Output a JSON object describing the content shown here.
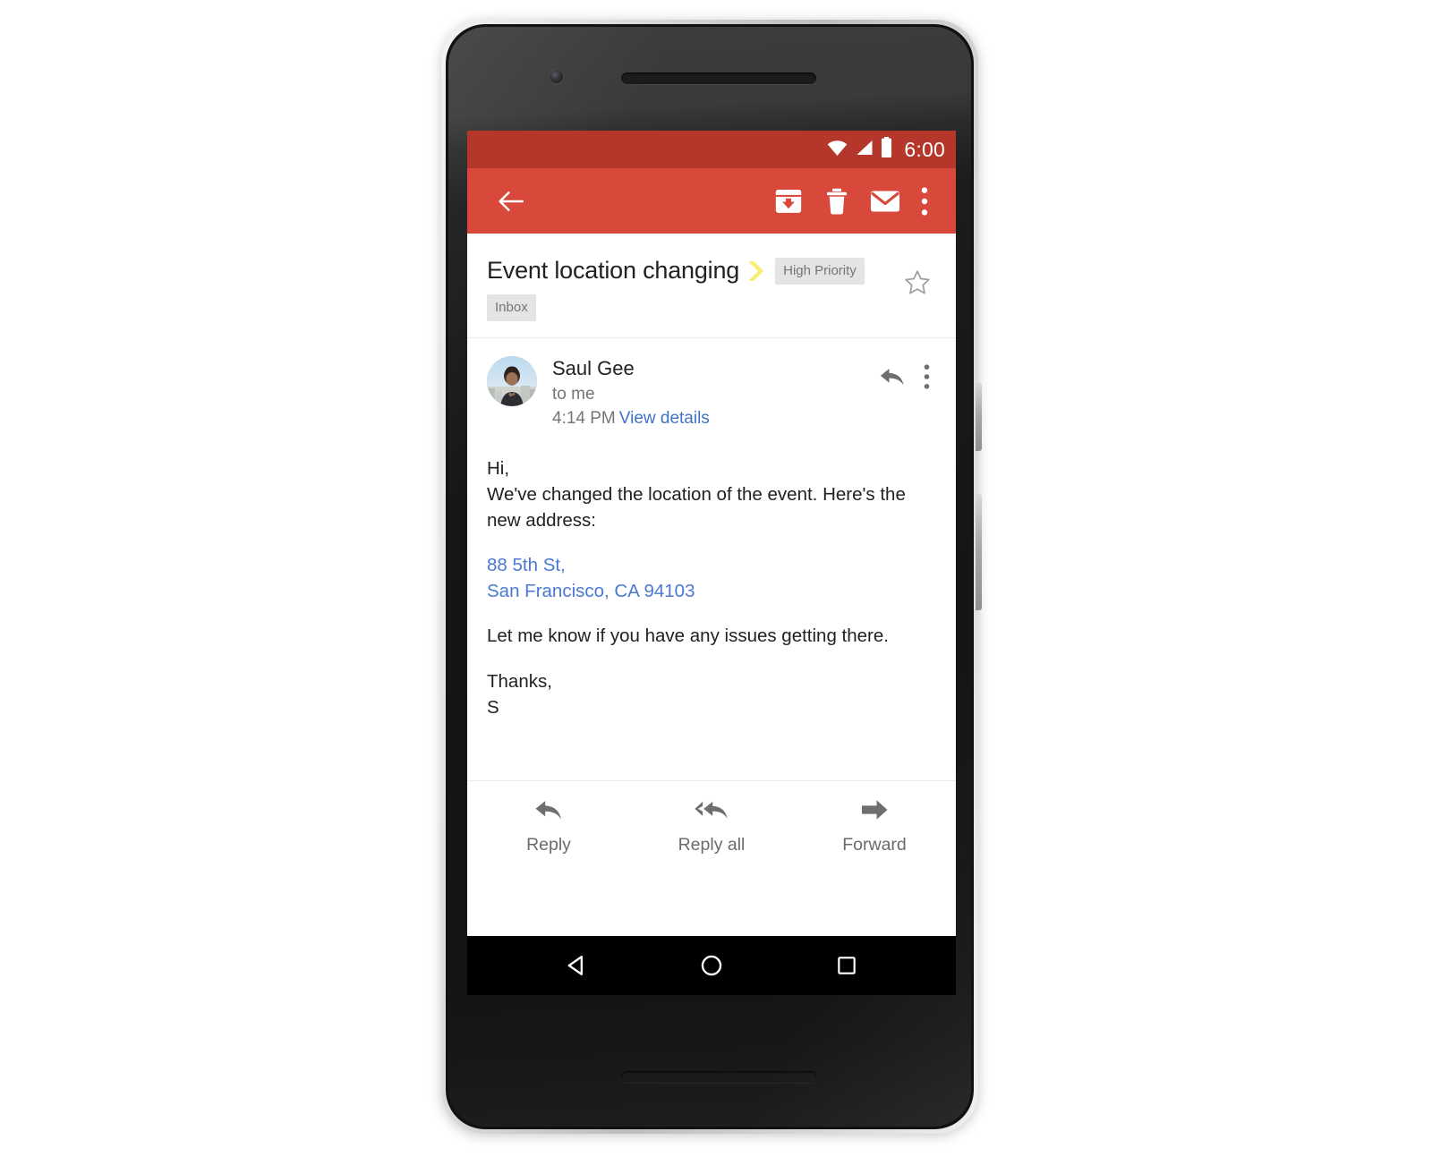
{
  "device": {
    "name": "android-smartphone",
    "front_camera": "front-camera-icon",
    "earpiece": "earpiece-speaker",
    "bottom_speaker": "bottom-speaker",
    "power_button": "power-button",
    "volume_button": "volume-button"
  },
  "status_bar": {
    "time": "6:00",
    "background": "#b5372c",
    "icons": [
      "wifi-icon",
      "cellular-signal-icon",
      "battery-icon"
    ]
  },
  "toolbar": {
    "background": "#d8483b",
    "back_icon": "back-arrow-icon",
    "archive_icon": "archive-icon",
    "delete_icon": "trash-icon",
    "mark_unread_icon": "envelope-icon",
    "overflow_icon": "overflow-menu-icon"
  },
  "subject": {
    "title": "Event location changing",
    "importance_marker": "importance-chevron-icon",
    "importance_color": "#f5ee6e",
    "priority_chip": "High Priority",
    "label_chip": "Inbox",
    "star_icon": "star-outline-icon",
    "starred": false
  },
  "message": {
    "sender_name": "Saul Gee",
    "recipient": "to me",
    "time": "4:14 PM",
    "details_link": "View details",
    "avatar": "sender-avatar-photo",
    "reply_icon": "reply-arrow-icon",
    "overflow_icon": "overflow-menu-icon",
    "body": {
      "greeting": "Hi,",
      "line_1": "We've changed the location of the event. Here's the new address:",
      "address_line_1": "88 5th St,",
      "address_line_2": "San Francisco, CA 94103",
      "line_2": "Let me know if you have any issues getting there.",
      "signoff": "Thanks,",
      "signature": "S",
      "link_color": "#4a79d4"
    }
  },
  "actions": [
    {
      "label": "Reply",
      "icon": "reply-arrow-icon"
    },
    {
      "label": "Reply all",
      "icon": "reply-all-arrow-icon"
    },
    {
      "label": "Forward",
      "icon": "forward-arrow-icon"
    }
  ],
  "nav_bar": {
    "back": "nav-back-triangle-icon",
    "home": "nav-home-circle-icon",
    "recents": "nav-recents-square-icon"
  }
}
